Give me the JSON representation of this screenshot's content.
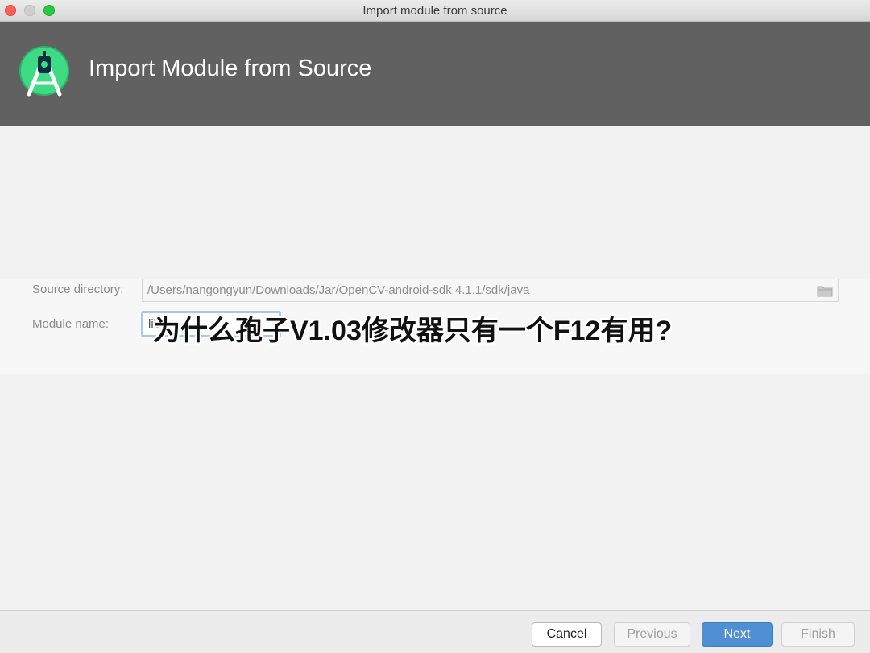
{
  "window": {
    "title": "Import module from source"
  },
  "header": {
    "title": "Import Module from Source",
    "logo_icon": "android-studio-logo-icon"
  },
  "form": {
    "source_directory_label": "Source directory:",
    "source_directory_value": "/Users/nangongyun/Downloads/Jar/OpenCV-android-sdk 4.1.1/sdk/java",
    "module_name_label": "Module name:",
    "module_name_value": "lib"
  },
  "overlay": {
    "text": "为什么孢子V1.03修改器只有一个F12有用?"
  },
  "buttons": {
    "cancel": "Cancel",
    "previous": "Previous",
    "next": "Next",
    "finish": "Finish"
  },
  "colors": {
    "header_bg": "#616161",
    "accent_blue": "#4f8fd4",
    "android_green": "#3ddc84"
  }
}
